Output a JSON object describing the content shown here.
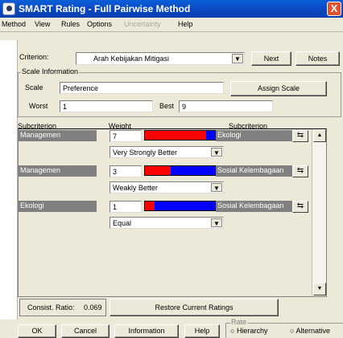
{
  "window": {
    "title": "SMART Rating - Full Pairwise Method",
    "close": "X"
  },
  "menu": {
    "items": [
      "Method",
      "View",
      "Rules",
      "Options",
      "Uncertainty",
      "Help"
    ]
  },
  "criterion": {
    "label": "Criterion:",
    "value": "Arah Kebijakan Mitigasi",
    "next": "Next",
    "notes": "Notes"
  },
  "scale": {
    "group_label": "Scale Information",
    "scale_label": "Scale",
    "scale_value": "Preference",
    "assign": "Assign Scale",
    "worst_label": "Worst",
    "worst_value": "1",
    "best_label": "Best",
    "best_value": "9"
  },
  "grid": {
    "headers": {
      "left": "Subcriterion",
      "weight": "Weight",
      "right": "Subcriterion"
    },
    "rows": [
      {
        "left": "Managemen",
        "weight": "7",
        "ratio": 0.79,
        "verbal": "Very Strongly Better",
        "right": "Ekologi",
        "swap": "⇆"
      },
      {
        "left": "Managemen",
        "weight": "3",
        "ratio": 0.33,
        "verbal": "Weakly Better",
        "right": "Sosial Kelembagaan",
        "swap": "⇆"
      },
      {
        "left": "Ekologi",
        "weight": "1",
        "ratio": 0.12,
        "verbal": "Equal",
        "right": "Sosial Kelembagaan",
        "swap": "⇆"
      }
    ]
  },
  "status": {
    "consist_label": "Consist. Ratio:",
    "consist_value": "0.069",
    "restore": "Restore Current Ratings"
  },
  "bottom": {
    "ok": "OK",
    "cancel": "Cancel",
    "information": "Information",
    "help": "Help",
    "rate_label": "Rate",
    "hierarchy": "Hierarchy",
    "alternative": "Alternative"
  },
  "colors": {
    "title_bar": "#0b48c4",
    "bar_left": "#ff0000",
    "bar_right": "#0000ff"
  },
  "icons": {
    "swap": "swap-icon",
    "combo": "dropdown-arrow-icon"
  }
}
